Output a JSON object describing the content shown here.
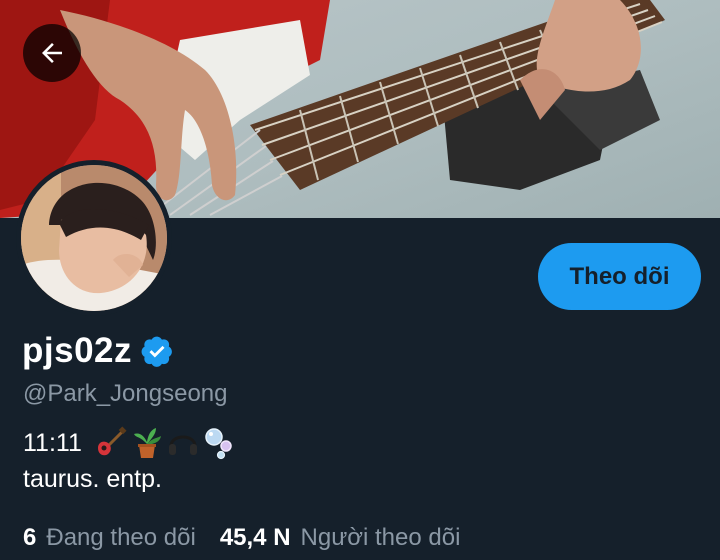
{
  "profile": {
    "display_name": "pjs02z",
    "handle": "@Park_Jongseong",
    "bio_time": "11:11",
    "bio_line2": "taurus. entp.",
    "verified": true
  },
  "actions": {
    "follow_label": "Theo dõi",
    "back_icon": "arrow-left-icon"
  },
  "stats": {
    "following_count": "6",
    "following_label": "Đang theo dõi",
    "followers_count": "45,4 N",
    "followers_label": "Người theo dõi"
  },
  "bio_emoji": [
    "guitar-icon",
    "potted-plant-icon",
    "headphones-icon",
    "bubbles-icon"
  ],
  "colors": {
    "background": "#15202b",
    "accent": "#1d9bf0",
    "secondary_text": "#8b98a5"
  }
}
